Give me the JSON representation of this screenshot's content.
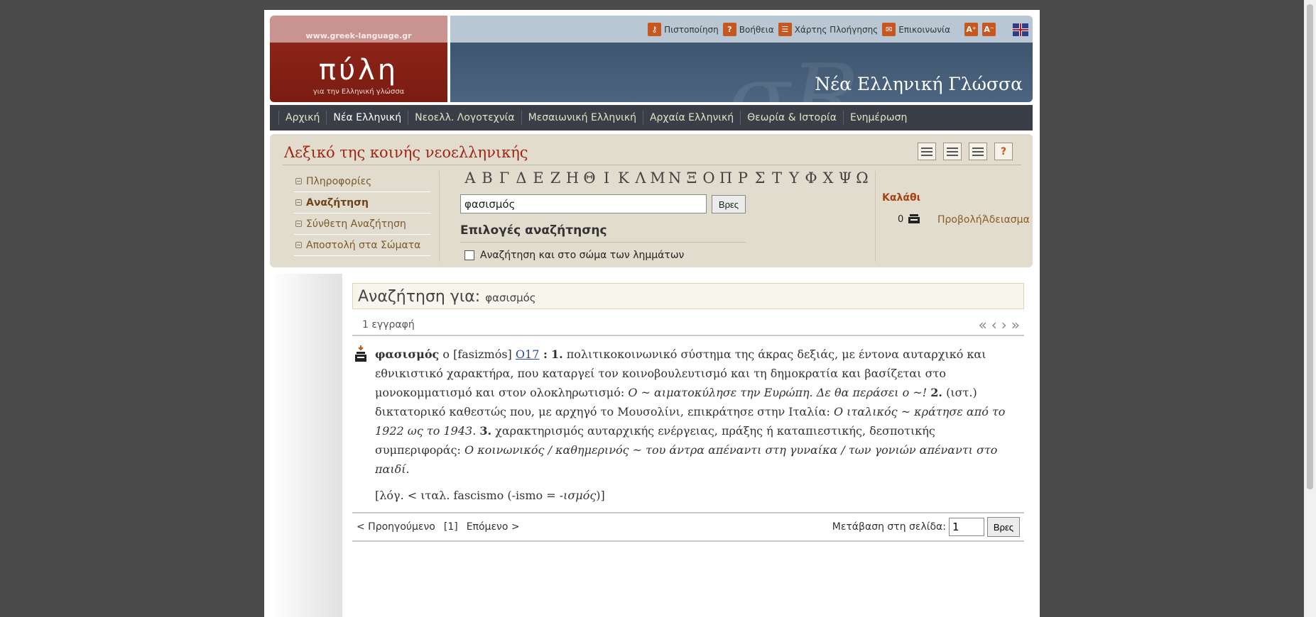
{
  "logo": {
    "url": "www.greek-language.gr",
    "big": "πύλη",
    "sub": "για την Ελληνική γλώσσα"
  },
  "banner": {
    "title": "Νέα Ελληνική Γλώσσα",
    "ghost": "σR"
  },
  "toplinks": {
    "certification": "Πιστοποίηση",
    "help": "Βοήθεια",
    "sitemap": "Χάρτης Πλοήγησης",
    "contact": "Επικοινωνία",
    "font_up": "A⁺",
    "font_down": "A⁻"
  },
  "nav": [
    "Αρχική",
    "Νέα Ελληνική",
    "Νεοελλ. Λογοτεχνία",
    "Μεσαιωνική Ελληνική",
    "Αρχαία Ελληνική",
    "Θεωρία & Ιστορία",
    "Ενημέρωση"
  ],
  "dict": {
    "title": "Λεξικό της κοινής νεοελληνικής",
    "menu": [
      "Πληροφορίες",
      "Αναζήτηση",
      "Σύνθετη Αναζήτηση",
      "Αποστολή στα Σώματα"
    ],
    "alphabet": [
      "Α",
      "Β",
      "Γ",
      "Δ",
      "Ε",
      "Ζ",
      "Η",
      "Θ",
      "Ι",
      "Κ",
      "Λ",
      "Μ",
      "Ν",
      "Ξ",
      "Ο",
      "Π",
      "Ρ",
      "Σ",
      "Τ",
      "Υ",
      "Φ",
      "Χ",
      "Ψ",
      "Ω"
    ],
    "search_value": "φασισμός",
    "search_button": "Βρες",
    "options_title": "Επιλογές αναζήτησης",
    "option_label": "Αναζήτηση και στο σώμα των λημμάτων",
    "help_label": "?",
    "basket": {
      "title": "Καλάθι",
      "count": "0",
      "view": "Προβολή",
      "empty": "Άδειασμα"
    }
  },
  "results": {
    "heading": "Αναζήτηση για:",
    "query": "φασισμός",
    "count": "1 εγγραφή",
    "pager": {
      "first": "«",
      "prev": "‹",
      "next": "›",
      "last": "»"
    },
    "entry": {
      "lemma": "φασισμός",
      "article": "ο",
      "pron": "[fasizmós]",
      "code": "Ο17",
      "colon": " :",
      "n1": "1.",
      "def1": "πολιτικοκοινωνικό σύστημα της άκρας δεξιάς, με έντονα αυταρχικό και εθνικιστικό χαρακτήρα, που καταργεί τον κοινοβουλευτισμό και τη δημοκρατία και βασίζεται στο μονοκομματισμό και στον ολοκληρωτισμό:",
      "ex1": "Ο ~ αιματοκύλησε την Ευρώπη. Δε θα περάσει ο ~!",
      "n2": "2.",
      "def2": "(ιστ.) δικτατορικό καθεστώς που, με αρχηγό το Μουσολίνι, επικράτησε στην Ιταλία:",
      "ex2": "Ο ιταλικός ~ κράτησε από το 1922 ως το 1943.",
      "n3": "3.",
      "def3": "χαρακτηρισμός αυταρχικής ενέργειας, πράξης ή καταπιεστικής, δεσποτικής συμπεριφοράς:",
      "ex3": "Ο κοινωνικός / καθημερινός ~ του άντρα απέναντι στη γυναίκα / των γονιών απέναντι στο παιδί.",
      "etym_pre": "[λόγ. < ιταλ. fascismo (-ismo = ",
      "etym_it": "-ισμός",
      "etym_post": ")]"
    },
    "prev": "< Προηγούμενο",
    "page": "[1]",
    "next": "Επόμενο >",
    "goto_label": "Μετάβαση στη σελίδα:",
    "goto_value": "1",
    "goto_button": "Βρες"
  }
}
